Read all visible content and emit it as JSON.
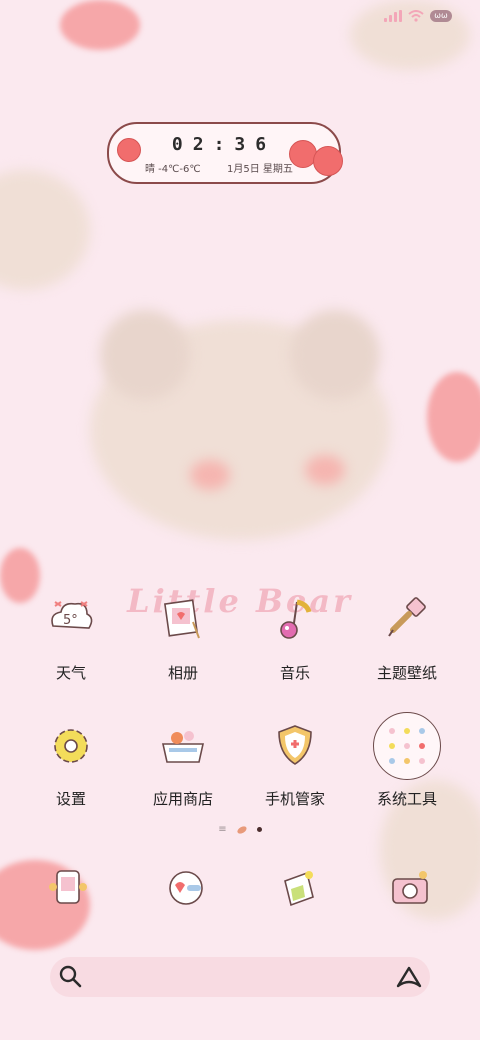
{
  "status": {
    "battery": "ωω"
  },
  "widget": {
    "time": "02:36",
    "weather": "晴 -4℃-6℃",
    "date": "1月5日 星期五"
  },
  "theme_title": "Little Bear",
  "apps": [
    {
      "label": "天气",
      "icon": "weather-icon",
      "badge": "5°"
    },
    {
      "label": "相册",
      "icon": "gallery-icon"
    },
    {
      "label": "音乐",
      "icon": "music-icon"
    },
    {
      "label": "主题壁纸",
      "icon": "theme-brush-icon"
    },
    {
      "label": "设置",
      "icon": "settings-gear-icon"
    },
    {
      "label": "应用商店",
      "icon": "app-store-basket-icon"
    },
    {
      "label": "手机管家",
      "icon": "phone-manager-shield-icon"
    },
    {
      "label": "系统工具",
      "icon": "system-tools-folder-icon"
    }
  ],
  "dock": [
    {
      "icon": "phone-icon"
    },
    {
      "icon": "messages-icon"
    },
    {
      "icon": "browser-icon"
    },
    {
      "icon": "camera-icon"
    }
  ],
  "colors": {
    "background": "#fbe9ef",
    "accent": "#f16d6d",
    "search": "#f8dbe2"
  }
}
